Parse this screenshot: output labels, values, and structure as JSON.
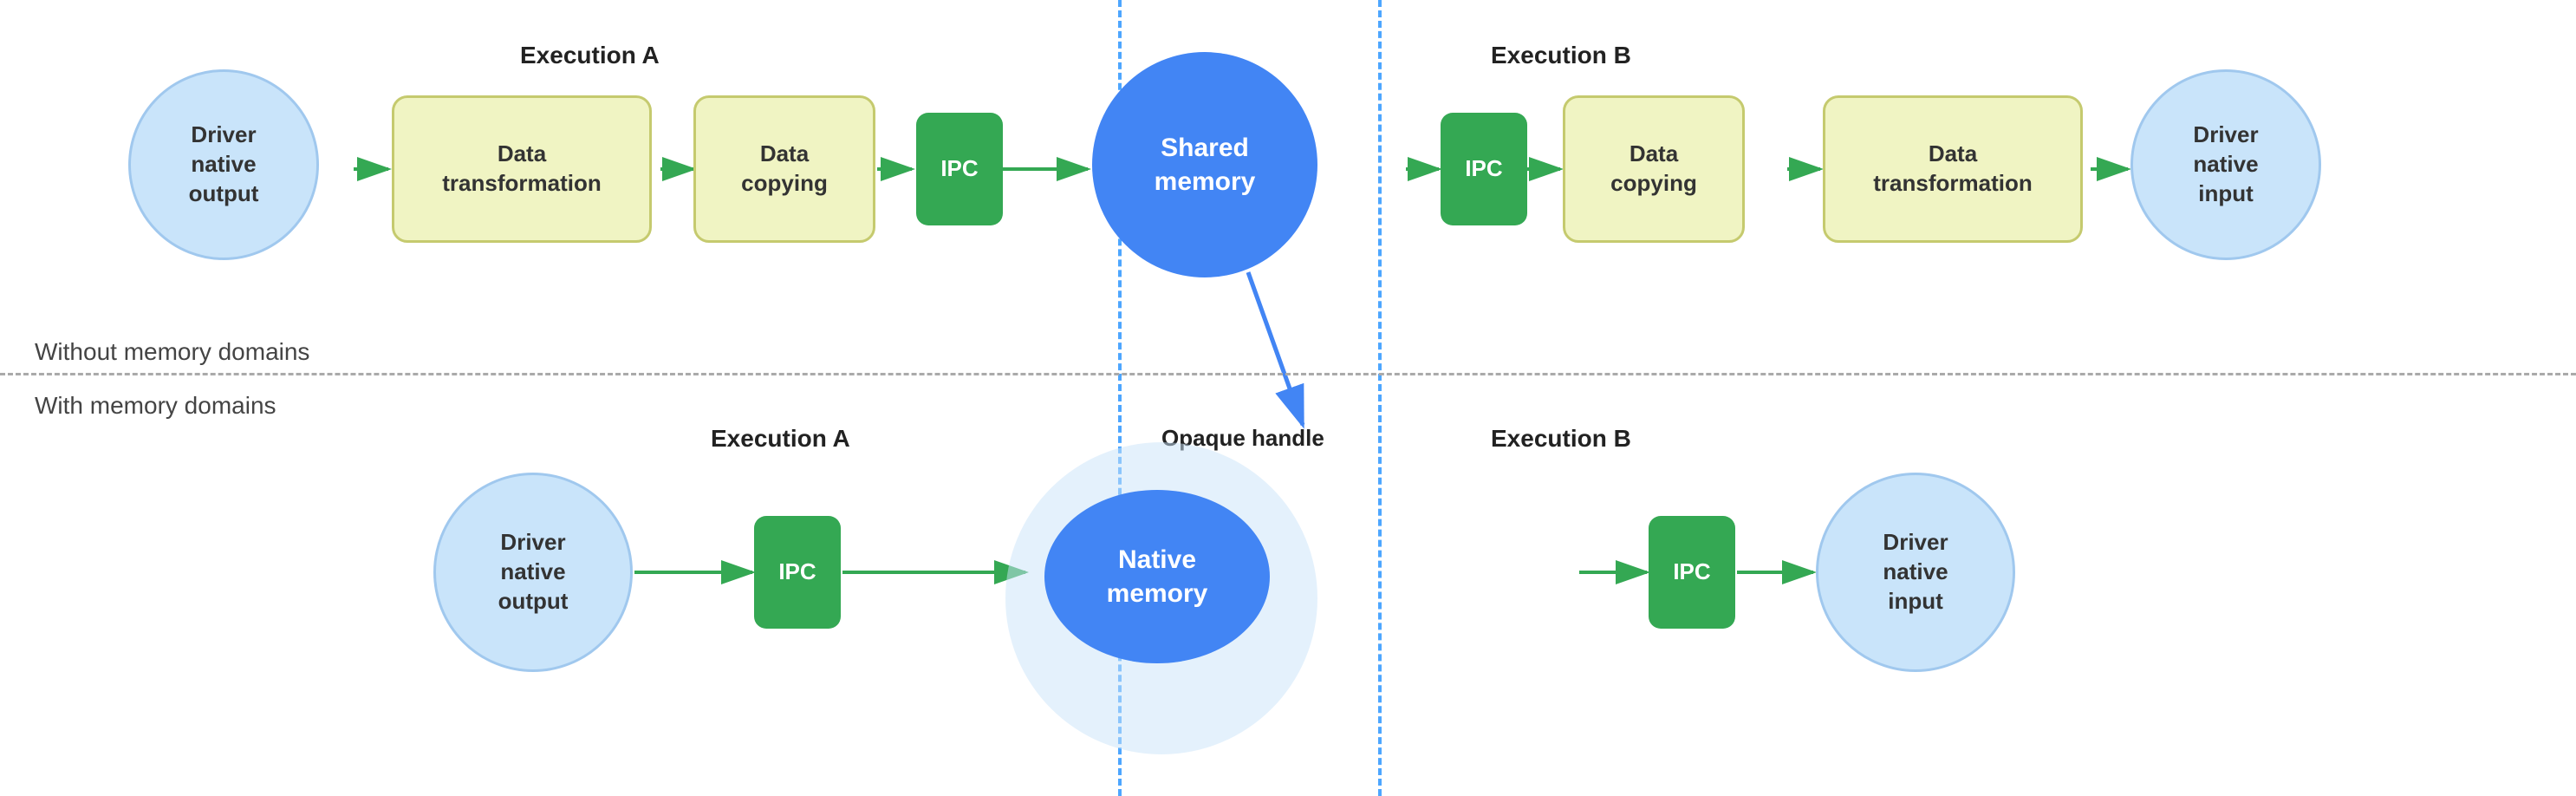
{
  "sections": {
    "without_label": "Without memory domains",
    "with_label": "With memory domains"
  },
  "top_row": {
    "exec_a_label": "Execution A",
    "exec_b_label": "Execution B",
    "nodes": [
      {
        "id": "driver_out_top",
        "text": "Driver\nnative\noutput",
        "type": "circle-light"
      },
      {
        "id": "data_transform_a",
        "text": "Data\ntransformation",
        "type": "rect-light"
      },
      {
        "id": "data_copy_a",
        "text": "Data\ncopying",
        "type": "rect-light"
      },
      {
        "id": "ipc_a_top",
        "text": "IPC",
        "type": "rect-green"
      },
      {
        "id": "shared_memory",
        "text": "Shared\nmemory",
        "type": "circle-blue"
      },
      {
        "id": "ipc_b_top",
        "text": "IPC",
        "type": "rect-green"
      },
      {
        "id": "data_copy_b",
        "text": "Data\ncopying",
        "type": "rect-light"
      },
      {
        "id": "data_transform_b",
        "text": "Data\ntransformation",
        "type": "rect-light"
      },
      {
        "id": "driver_in_top",
        "text": "Driver\nnative\ninput",
        "type": "circle-light"
      }
    ]
  },
  "bottom_row": {
    "exec_a_label": "Execution A",
    "exec_b_label": "Execution B",
    "opaque_label": "Opaque handle",
    "nodes": [
      {
        "id": "driver_out_bottom",
        "text": "Driver\nnative\noutput",
        "type": "circle-light"
      },
      {
        "id": "ipc_a_bottom",
        "text": "IPC",
        "type": "rect-green"
      },
      {
        "id": "native_memory_bg",
        "text": "",
        "type": "circle-large-light"
      },
      {
        "id": "native_memory",
        "text": "Native\nmemory",
        "type": "circle-native"
      },
      {
        "id": "ipc_b_bottom",
        "text": "IPC",
        "type": "rect-green"
      },
      {
        "id": "driver_in_bottom",
        "text": "Driver\nnative\ninput",
        "type": "circle-light"
      }
    ]
  },
  "colors": {
    "green": "#34a853",
    "blue": "#4285f4",
    "light_blue_circle": "#c9e4fa",
    "light_yellow_rect": "#f0f4c3",
    "dashed_line": "#4da6ff",
    "separator": "#aaa",
    "arrow": "#34a853",
    "blue_arrow": "#4285f4"
  }
}
